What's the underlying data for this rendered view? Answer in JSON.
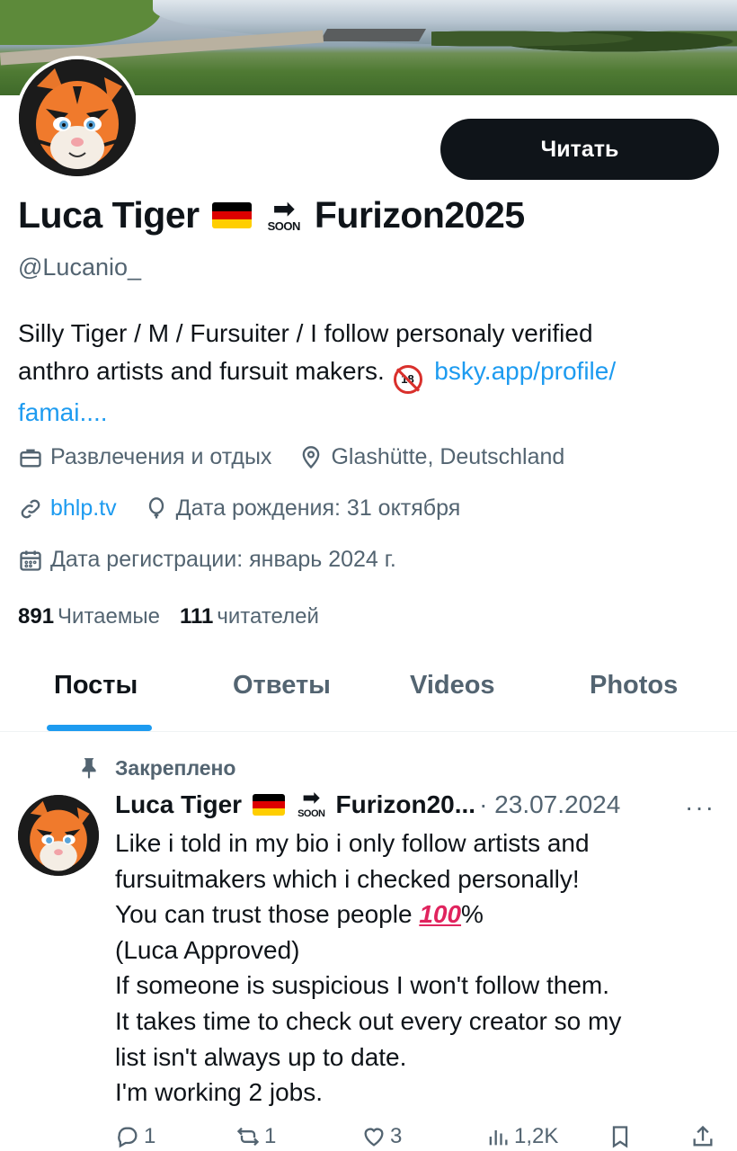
{
  "profile": {
    "follow_label": "Читать",
    "name": "Luca Tiger",
    "soon_label": "SOON",
    "event": "Furizon2025",
    "handle": "@Lucanio_",
    "bio": {
      "line1": "Silly Tiger / M / Fursuiter / I follow personaly verified",
      "line2": "anthro artists and fursuit makers.",
      "adult_badge": "18",
      "link_part1": "bsky.app/profile/",
      "link_part2": "famai...."
    },
    "meta": {
      "category": "Развлечения и отдых",
      "location": "Glashütte, Deutschland",
      "website": "bhlp.tv",
      "birthday": "Дата рождения: 31 октября",
      "joined": "Дата регистрации: январь 2024 г."
    },
    "stats": {
      "following_count": "891",
      "following_label": "Читаемые",
      "followers_count": "111",
      "followers_label": "читателей"
    }
  },
  "tabs": [
    "Посты",
    "Ответы",
    "Videos",
    "Photos"
  ],
  "post": {
    "pinned_label": "Закреплено",
    "author": "Luca Tiger",
    "event_truncated": "Furizon20...",
    "date": "· 23.07.2024",
    "more": "···",
    "lines": {
      "l1": "Like i told in my bio i only follow artists and",
      "l2": "fursuitmakers which i checked personally!",
      "l3a": "You can trust those people",
      "hundred": "100",
      "l3b": "%",
      "l4": "(Luca Approved)",
      "l5": "If someone is suspicious I won't follow them.",
      "l6": "It takes time to check out every creator so my",
      "l7": "list isn't always up to date.",
      "l8": "I'm working 2 jobs."
    },
    "actions": {
      "replies": "1",
      "reposts": "1",
      "likes": "3",
      "views": "1,2K"
    }
  },
  "colors": {
    "accent": "#1d9bf0",
    "text": "#0f1419",
    "secondary": "#536471",
    "button": "#0f1419"
  }
}
